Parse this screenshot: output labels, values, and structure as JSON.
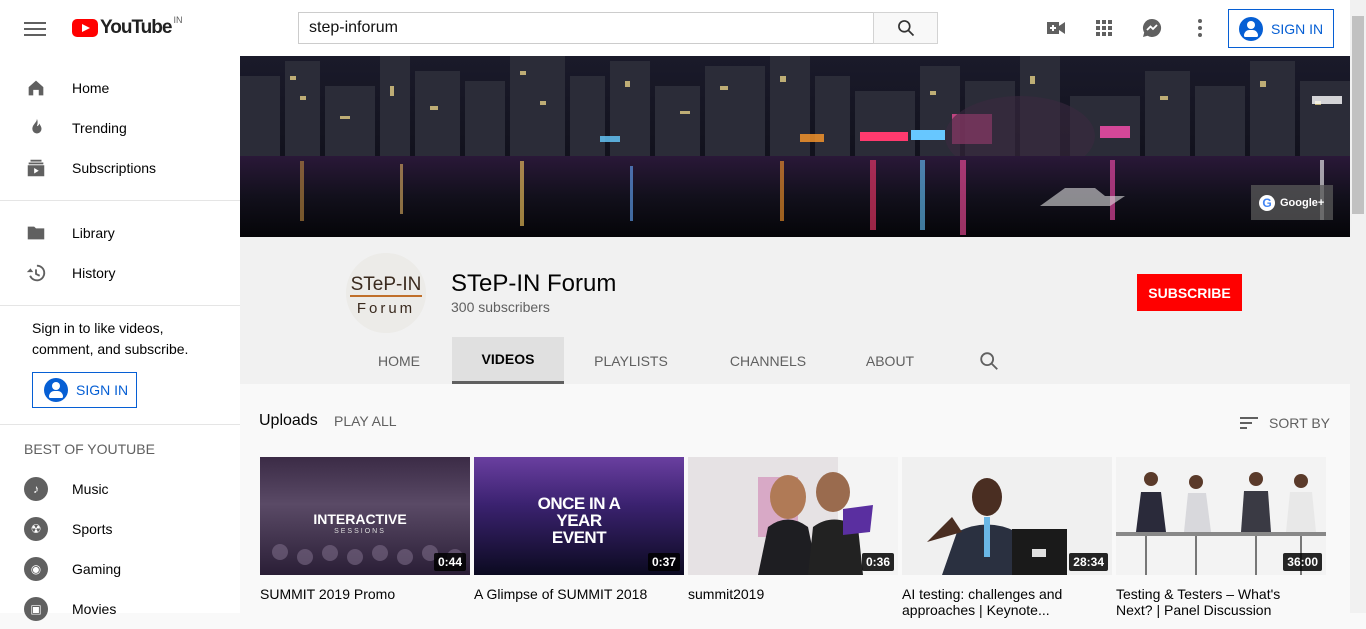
{
  "header": {
    "logo_text": "YouTube",
    "country_code": "IN",
    "search_value": "step-inforum",
    "sign_in_label": "SIGN IN"
  },
  "sidebar": {
    "primary": [
      {
        "label": "Home",
        "icon": "home-icon"
      },
      {
        "label": "Trending",
        "icon": "trending-icon"
      },
      {
        "label": "Subscriptions",
        "icon": "subscriptions-icon"
      }
    ],
    "secondary": [
      {
        "label": "Library",
        "icon": "library-icon"
      },
      {
        "label": "History",
        "icon": "history-icon"
      }
    ],
    "signin_prompt": "Sign in to like videos, comment, and subscribe.",
    "signin_label": "SIGN IN",
    "best_of_heading": "BEST OF YOUTUBE",
    "best_of": [
      {
        "label": "Music",
        "icon": "music-icon"
      },
      {
        "label": "Sports",
        "icon": "sports-icon"
      },
      {
        "label": "Gaming",
        "icon": "gaming-icon"
      },
      {
        "label": "Movies",
        "icon": "movies-icon"
      }
    ]
  },
  "banner": {
    "google_plus_label": "Google+"
  },
  "channel": {
    "avatar_text_top": "STeP-IN",
    "avatar_text_bottom": "Forum",
    "name": "STeP-IN Forum",
    "subscribers": "300 subscribers",
    "subscribe_label": "SUBSCRIBE",
    "tabs": [
      "HOME",
      "VIDEOS",
      "PLAYLISTS",
      "CHANNELS",
      "ABOUT"
    ],
    "active_tab": "VIDEOS"
  },
  "uploads": {
    "heading": "Uploads",
    "play_all": "PLAY ALL",
    "sort_by": "SORT BY",
    "videos": [
      {
        "title": "SUMMIT 2019 Promo",
        "duration": "0:44",
        "thumb_text": "INTERACTIVE",
        "thumb_subtext": "SESSIONS"
      },
      {
        "title": "A Glimpse of SUMMIT 2018",
        "duration": "0:37",
        "thumb_text": "ONCE IN A YEAR EVENT"
      },
      {
        "title": "summit2019",
        "duration": "0:36"
      },
      {
        "title": "AI testing: challenges and approaches | Keynote...",
        "duration": "28:34"
      },
      {
        "title": "Testing & Testers – What's Next? | Panel Discussion",
        "duration": "36:00"
      }
    ]
  },
  "colors": {
    "brand_red": "#ff0000",
    "link_blue": "#065fd4"
  }
}
